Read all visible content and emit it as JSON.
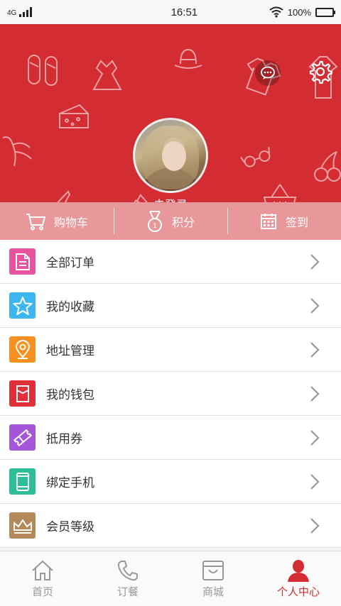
{
  "status_bar": {
    "network": "4G",
    "time": "16:51",
    "battery_percent": "100%",
    "icons": [
      "signal-icon",
      "wifi-icon",
      "battery-icon"
    ]
  },
  "header": {
    "login_label": "未登录",
    "message_icon": "message-icon",
    "settings_icon": "gear-icon",
    "background_color": "#d32c33"
  },
  "quick_actions": [
    {
      "label": "购物车",
      "icon": "cart-icon"
    },
    {
      "label": "积分",
      "icon": "medal-icon"
    },
    {
      "label": "签到",
      "icon": "calendar-icon"
    }
  ],
  "menu": [
    {
      "label": "全部订单",
      "icon": "document-icon",
      "color": "#e9529e"
    },
    {
      "label": "我的收藏",
      "icon": "star-icon",
      "color": "#3bb6f0"
    },
    {
      "label": "地址管理",
      "icon": "location-icon",
      "color": "#f7901e"
    },
    {
      "label": "我的钱包",
      "icon": "wallet-icon",
      "color": "#e2303a"
    },
    {
      "label": "抵用券",
      "icon": "ticket-icon",
      "color": "#a655d8"
    },
    {
      "label": "绑定手机",
      "icon": "phone-icon",
      "color": "#2cbf97"
    },
    {
      "label": "会员等级",
      "icon": "crown-icon",
      "color": "#b5885a"
    }
  ],
  "tabs": [
    {
      "label": "首页",
      "icon": "home-icon",
      "active": false
    },
    {
      "label": "订餐",
      "icon": "phone-call-icon",
      "active": false
    },
    {
      "label": "商城",
      "icon": "shop-bag-icon",
      "active": false
    },
    {
      "label": "个人中心",
      "icon": "user-icon",
      "active": true
    }
  ],
  "accent_color": "#d32c33"
}
